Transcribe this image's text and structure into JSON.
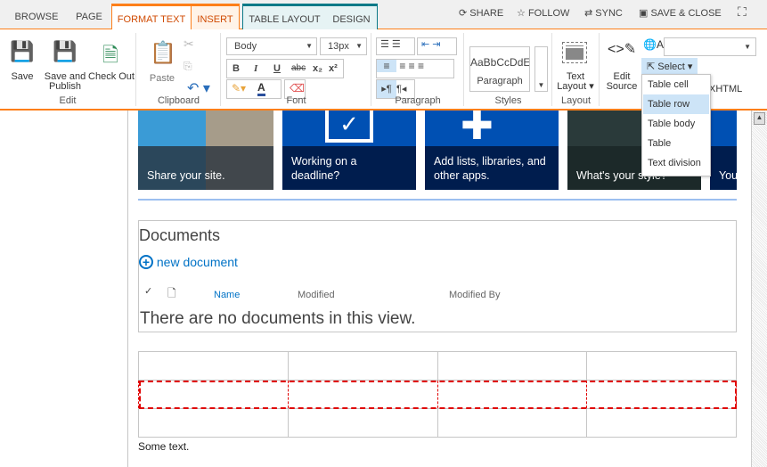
{
  "tabs": [
    {
      "label": "BROWSE"
    },
    {
      "label": "PAGE"
    },
    {
      "label": "FORMAT TEXT"
    },
    {
      "label": "INSERT"
    },
    {
      "label": "TABLE LAYOUT"
    },
    {
      "label": "DESIGN"
    }
  ],
  "top_actions": {
    "share": "SHARE",
    "follow": "FOLLOW",
    "sync": "SYNC",
    "save_close": "SAVE & CLOSE"
  },
  "ribbon": {
    "edit": {
      "label": "Edit",
      "save": "Save",
      "save_publish_1": "Save and",
      "save_publish_2": "Publish",
      "checkout": "Check Out"
    },
    "clipboard": {
      "label": "Clipboard",
      "paste": "Paste"
    },
    "font": {
      "label": "Font",
      "style": "Body",
      "size": "13px",
      "bold": "B",
      "italic": "I",
      "underline": "U",
      "strike": "abc",
      "sub": "x₂",
      "sup": "x²",
      "color": "A"
    },
    "paragraph": {
      "label": "Paragraph"
    },
    "styles": {
      "label": "Styles",
      "preview": "AaBbCcDdE",
      "name": "Paragraph"
    },
    "layout": {
      "label": "Layout",
      "text_layout_1": "Text",
      "text_layout_2": "Layout"
    },
    "markup": {
      "edit_source_1": "Edit",
      "edit_source_2": "Source",
      "select": "Select",
      "xhtml": "XHTML",
      "language_value": ""
    }
  },
  "select_menu": {
    "items": [
      "Table cell",
      "Table row",
      "Table body",
      "Table",
      "Text division"
    ],
    "highlighted": "Table row"
  },
  "tiles": [
    {
      "text": "Share your site."
    },
    {
      "text": "Working on a deadline?"
    },
    {
      "text": "Add lists, libraries, and other apps."
    },
    {
      "text": "What's your style?"
    },
    {
      "text": "You"
    }
  ],
  "documents": {
    "title": "Documents",
    "new": "new document",
    "columns": [
      "Name",
      "Modified",
      "Modified By"
    ],
    "empty": "There are no documents in this view."
  },
  "body_text": "Some text.",
  "colors": {
    "accent": "#fd7f1a",
    "table_tab": "#0b7a88",
    "tile_blue": "#0050b3",
    "link": "#0072c6",
    "selection": "#e00000"
  }
}
